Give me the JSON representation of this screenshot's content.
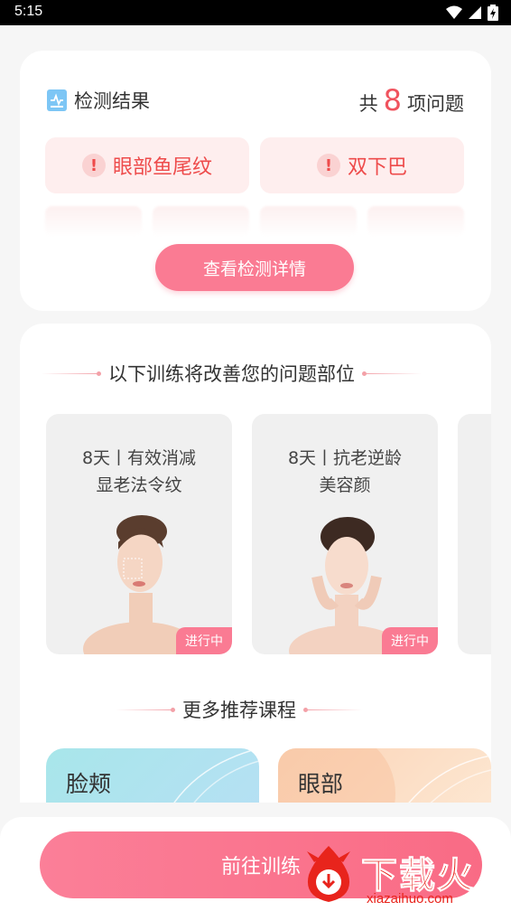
{
  "status_bar": {
    "time": "5:15"
  },
  "result": {
    "title": "检测结果",
    "count_prefix": "共",
    "count": "8",
    "count_suffix": "项问题",
    "issues": [
      "眼部鱼尾纹",
      "双下巴"
    ],
    "details_button": "查看检测详情"
  },
  "training": {
    "heading": "以下训练将改善您的问题部位",
    "courses": [
      {
        "line1": "8天丨有效消减",
        "line2": "显老法令纹",
        "badge": "进行中"
      },
      {
        "line1": "8天丨抗老逆龄",
        "line2": "美容颜",
        "badge": "进行中"
      }
    ],
    "more_heading": "更多推荐课程",
    "recommended": [
      "脸颊",
      "眼部"
    ]
  },
  "bottom": {
    "go_button": "前往训练"
  },
  "watermark": {
    "name": "下载火",
    "url": "xiazaihuo.com"
  },
  "colors": {
    "accent": "#fa7b93",
    "issue_text": "#ee4b4b",
    "count": "#f0535e"
  }
}
